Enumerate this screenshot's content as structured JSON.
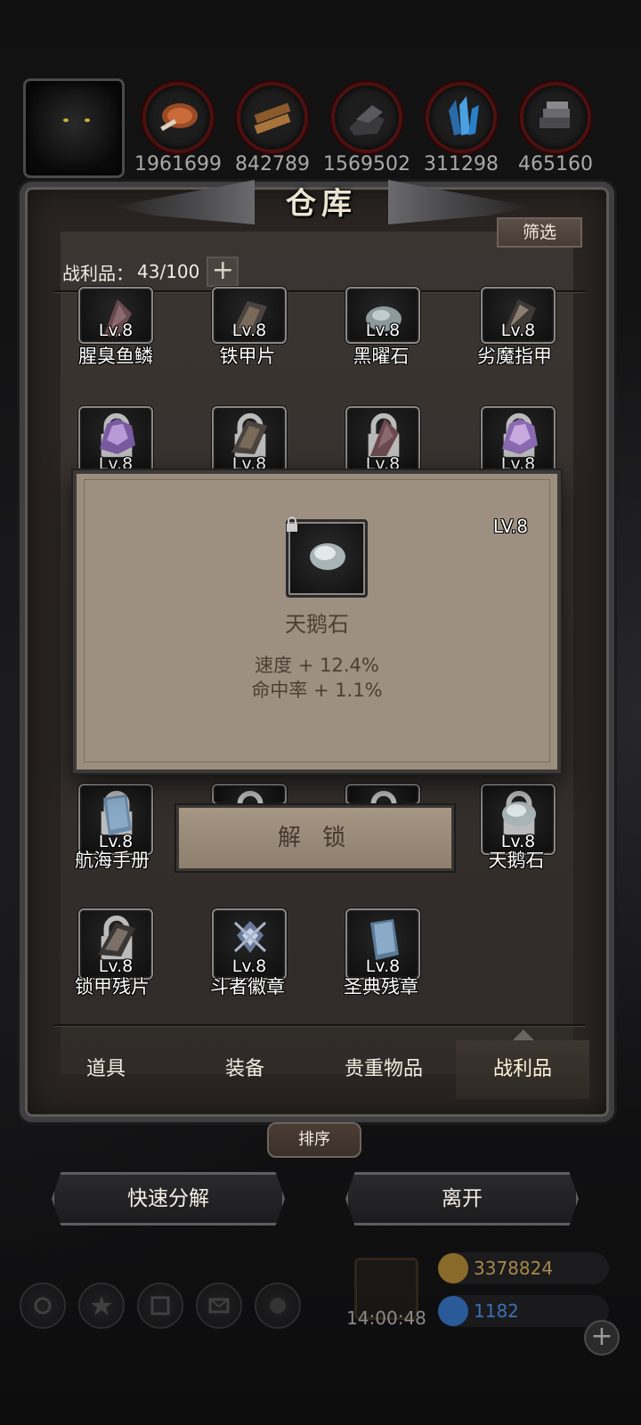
{
  "resources": [
    {
      "icon": "meat-icon",
      "value": "1961699"
    },
    {
      "icon": "wood-icon",
      "value": "842789"
    },
    {
      "icon": "stone-icon",
      "value": "1569502"
    },
    {
      "icon": "crystal-icon",
      "value": "311298"
    },
    {
      "icon": "iron-icon",
      "value": "465160"
    }
  ],
  "panel": {
    "title": "仓库",
    "filter_label": "筛选",
    "count_label": "战利品：",
    "count_value": "43/100",
    "plus_label": "+"
  },
  "items": [
    {
      "name": "腥臭鱼鳞",
      "level": "Lv.8",
      "icon": "fish-scale-icon",
      "locked": false
    },
    {
      "name": "铁甲片",
      "level": "Lv.8",
      "icon": "iron-plate-icon",
      "locked": false
    },
    {
      "name": "黑曜石",
      "level": "Lv.8",
      "icon": "obsidian-icon",
      "locked": false
    },
    {
      "name": "劣魔指甲",
      "level": "Lv.8",
      "icon": "claw-icon",
      "locked": false
    },
    {
      "name": "",
      "level": "Lv.8",
      "icon": "amethyst-icon",
      "locked": true
    },
    {
      "name": "",
      "level": "Lv.8",
      "icon": "iron-plate-icon",
      "locked": true
    },
    {
      "name": "",
      "level": "Lv.8",
      "icon": "fish-scale-icon",
      "locked": true
    },
    {
      "name": "",
      "level": "Lv.8",
      "icon": "amethyst-icon",
      "locked": true
    },
    {
      "name": "航海手册",
      "level": "Lv.8",
      "icon": "manual-icon",
      "locked": true
    },
    {
      "name": "",
      "level": "",
      "icon": "item-icon",
      "locked": true
    },
    {
      "name": "",
      "level": "",
      "icon": "item-icon",
      "locked": true
    },
    {
      "name": "天鹅石",
      "level": "Lv.8",
      "icon": "swan-stone-icon",
      "locked": true
    },
    {
      "name": "锁甲残片",
      "level": "Lv.8",
      "icon": "chain-fragment-icon",
      "locked": true
    },
    {
      "name": "斗者徽章",
      "level": "Lv.8",
      "icon": "badge-icon",
      "locked": false
    },
    {
      "name": "圣典残章",
      "level": "Lv.8",
      "icon": "scripture-icon",
      "locked": false
    }
  ],
  "popup": {
    "level": "LV.8",
    "name": "天鹅石",
    "stats": [
      "速度 + 12.4%",
      "命中率 + 1.1%"
    ],
    "unlock_label": "解 锁"
  },
  "tabs": [
    {
      "label": "道具",
      "active": false
    },
    {
      "label": "装备",
      "active": false
    },
    {
      "label": "贵重物品",
      "active": false
    },
    {
      "label": "战利品",
      "active": true
    }
  ],
  "actions": {
    "sort_label": "排序",
    "decompose_label": "快速分解",
    "leave_label": "离开"
  },
  "hud": {
    "timer": "14:00:48",
    "gold": "3378824",
    "gems": "1182",
    "plus_label": "+",
    "gold_color": "#a8874a",
    "gem_color": "#3b6fb0"
  }
}
